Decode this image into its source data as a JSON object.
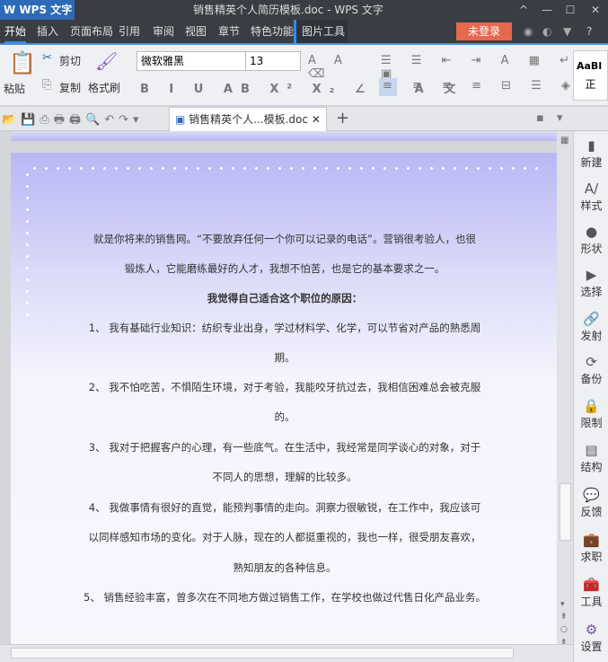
{
  "app": {
    "logo": "W WPS 文字 ▾",
    "title": "销售精英个人简历模板.doc - WPS 文字",
    "window_buttons": [
      "^",
      "—",
      "☐",
      "✕"
    ]
  },
  "menu": {
    "items": [
      "开始",
      "插入",
      "页面布局",
      "引用",
      "审阅",
      "视图",
      "章节",
      "特色功能",
      "图片工具"
    ],
    "login": "未登录",
    "help": "?"
  },
  "ribbon": {
    "paste": "粘贴",
    "cut": "剪切",
    "copy": "复制",
    "format_painter": "格式刷",
    "font": "微软雅黑",
    "size": "13",
    "style_preview": "AaBl",
    "style_name": "正"
  },
  "tabs": {
    "doc_tab": "销售精英个人...模板.doc",
    "close": "✕",
    "new": "+"
  },
  "document": {
    "lines": [
      "就是你将来的销售网。“不要放弃任何一个你可以记录的电话”。营销很考验人，也很",
      "锻炼人，它能磨练最好的人才，我想不怕苦，也是它的基本要求之一。",
      "我觉得自己适合这个职位的原因：",
      "1、  我有基础行业知识：纺织专业出身，学过材料学、化学，可以节省对产品的熟悉周",
      "期。",
      "2、  我不怕吃苦，不惧陌生环境，对于考验，我能咬牙抗过去，我相信困难总会被克服",
      "的。",
      "3、  我对于把握客户的心理，有一些底气。在生活中，我经常是同学谈心的对象，对于",
      "不同人的思想，理解的比较多。",
      "4、  我做事情有很好的直觉，能预判事情的走向。洞察力很敏锐，在工作中，我应该可",
      "以同样感知市场的变化。对于人脉，现在的人都挺重视的，我也一样，很受朋友喜欢，",
      "熟知朋友的各种信息。",
      "5、 销售经验丰富，曾多次在不同地方做过销售工作，在学校也做过代售日化产品业务。"
    ]
  },
  "sidebar": {
    "items": [
      "新建",
      "样式",
      "形状",
      "选择",
      "发射",
      "备份",
      "限制",
      "结构",
      "反馈",
      "求职",
      "工具",
      "设置"
    ],
    "icons": [
      "▮",
      "A/",
      "●",
      "▶",
      "🔗",
      "⟳",
      "🔒",
      "▤",
      "💬",
      "💼",
      "🧰",
      "⚙"
    ]
  },
  "colors": {
    "accent": "#2d6ab8",
    "login": "#e5694d",
    "job": "#3d7cc9",
    "tools": "#c9432f",
    "settings": "#7a4f9a"
  }
}
